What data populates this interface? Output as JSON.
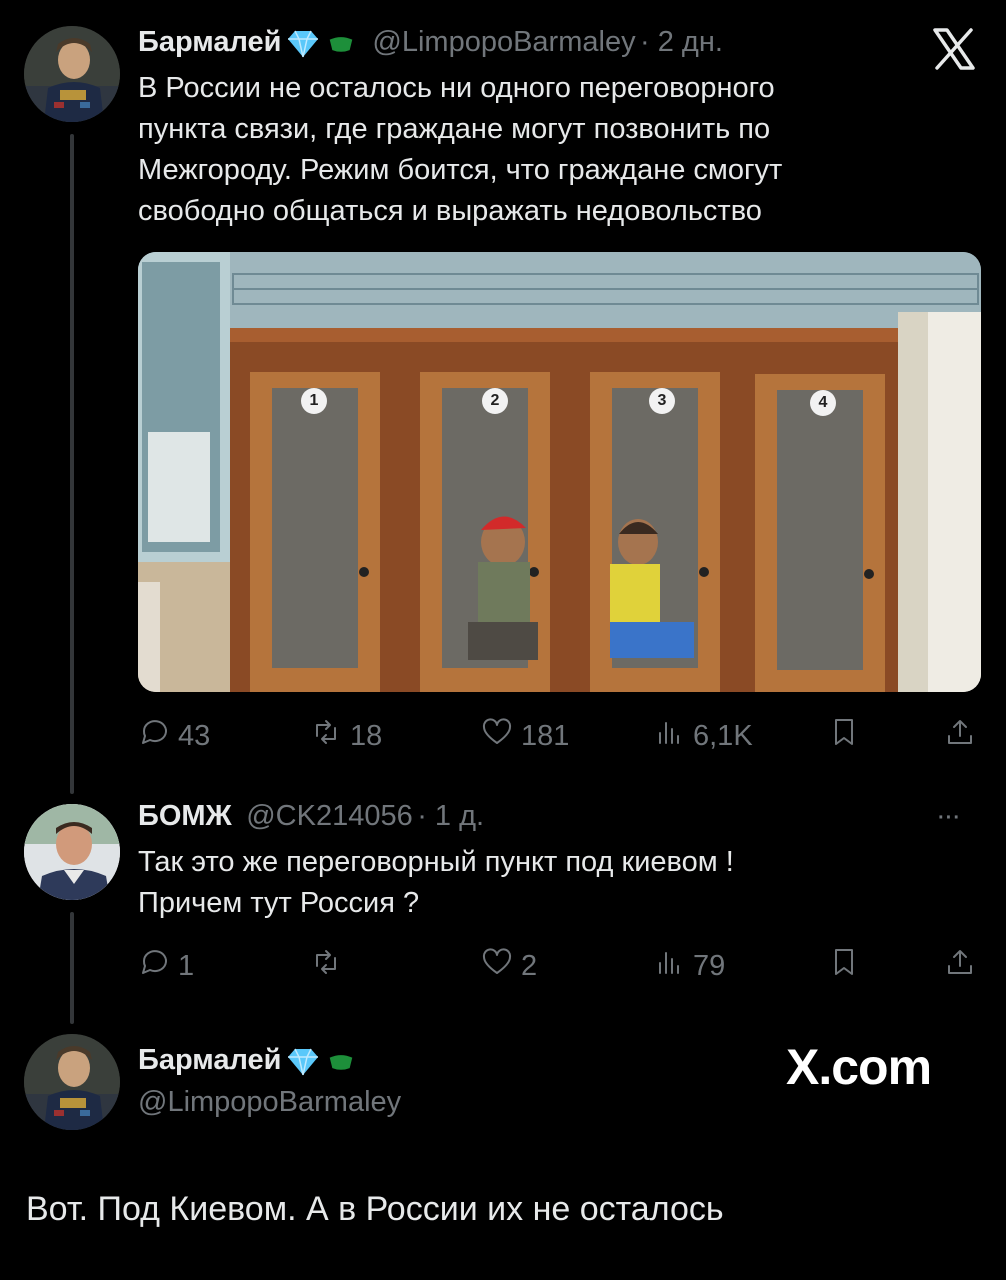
{
  "tweet1": {
    "name": "Бармалей",
    "handle": "@LimpopoBarmaley",
    "time": "· 2 дн.",
    "text_lines": [
      "В России не осталось ни одного переговорного",
      "пункта связи, где граждане могут позвонить по",
      "Межгороду. Режим боится, что граждане смогут",
      "свободно общаться и выражать недовольство"
    ],
    "booth_numbers": [
      "1",
      "2",
      "3",
      "4"
    ],
    "stats": {
      "replies": "43",
      "reposts": "18",
      "likes": "181",
      "views": "6,1K"
    }
  },
  "reply": {
    "name": "БОМЖ",
    "handle": "@CK214056",
    "time": "· 1 д.",
    "more": "···",
    "text_lines": [
      "Так это же переговорный пункт под киевом !",
      "Причем тут Россия ?"
    ],
    "stats": {
      "replies": "1",
      "reposts": "",
      "likes": "2",
      "views": "79"
    }
  },
  "quote": {
    "name": "Бармалей",
    "handle": "@LimpopoBarmaley",
    "brand": "X.com"
  },
  "caption": "Вот. Под Киевом. А в России их не осталось",
  "icons": {
    "verified": "diamond-icon",
    "emoji": "green-cap-icon",
    "logo": "x-logo-icon",
    "reply": "reply-icon",
    "repost": "repost-icon",
    "like": "heart-icon",
    "views": "views-icon",
    "bookmark": "bookmark-icon",
    "share": "share-icon"
  },
  "colors": {
    "background": "#000000",
    "text": "#e7e9ea",
    "secondary": "#71767b",
    "verified": "#5ac8fa",
    "emoji": "#1d8f3a"
  }
}
